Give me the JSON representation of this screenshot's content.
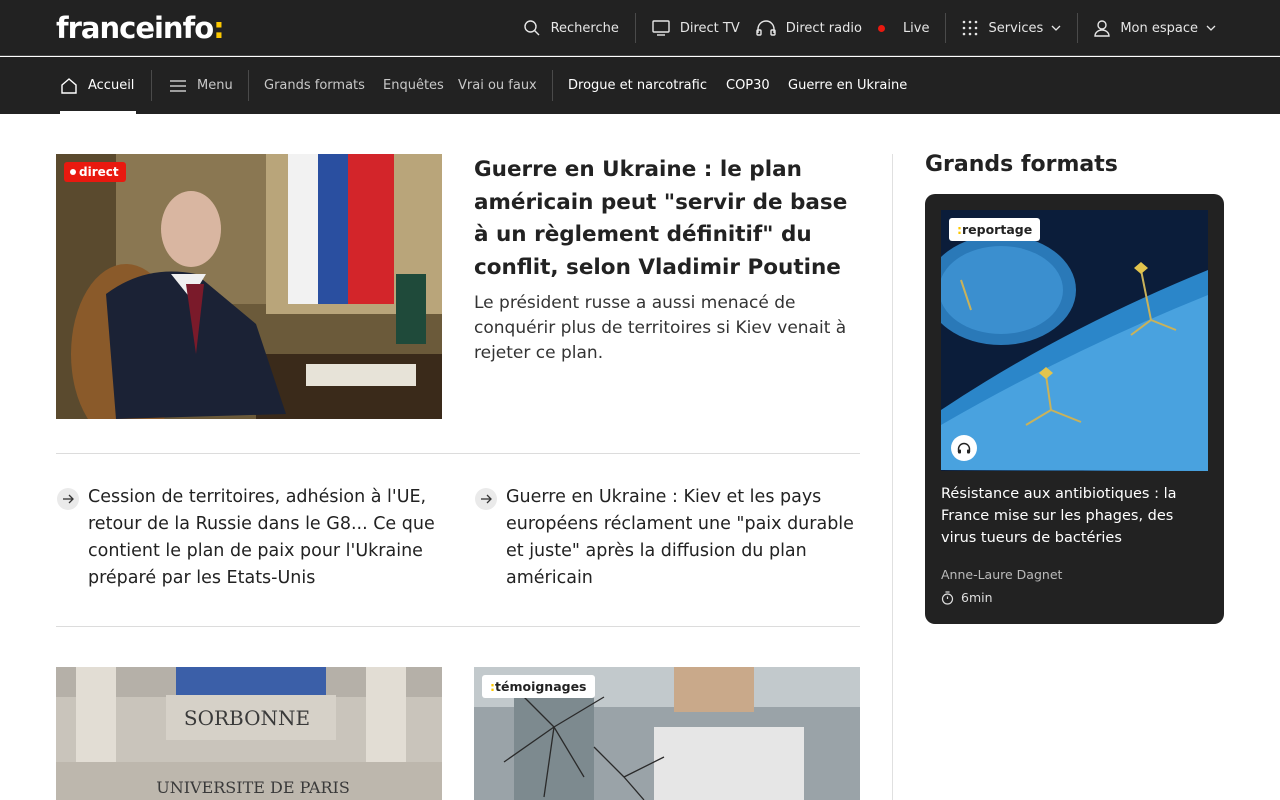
{
  "header": {
    "logo_text": "franceinfo",
    "logo_colon": ":",
    "nav": {
      "search": "Recherche",
      "direct_tv": "Direct TV",
      "direct_radio": "Direct radio",
      "live": "Live",
      "services": "Services",
      "account": "Mon espace"
    }
  },
  "subnav": {
    "home": "Accueil",
    "menu": "Menu",
    "grands_formats": "Grands formats",
    "enquetes": "Enquêtes",
    "vrai_ou_faux": "Vrai ou faux",
    "topic1": "Drogue et narcotrafic",
    "topic2": "COP30",
    "topic3": "Guerre en Ukraine"
  },
  "hero": {
    "badge": "direct",
    "title": "Guerre en Ukraine : le plan américain peut \"servir de base à un règlement définitif\" du conflit, selon Vladimir Poutine",
    "description": "Le président russe a aussi menacé de conquérir plus de territoires si Kiev venait à rejeter ce plan."
  },
  "related": [
    {
      "title": "Cession de territoires, adhésion à l'UE, retour de la Russie dans le G8... Ce que contient le plan de paix pour l'Ukraine préparé par les Etats-Unis"
    },
    {
      "title": "Guerre en Ukraine : Kiev et les pays européens réclament une \"paix durable et juste\" après la diffusion du plan américain"
    }
  ],
  "cards": [
    {
      "sign_top": "SORBONNE",
      "sign_bottom": "UNIVERSITE DE PARIS"
    },
    {
      "tag": "témoignages"
    }
  ],
  "grands_formats": {
    "section_title": "Grands formats",
    "tag": "reportage",
    "headline": "Résistance aux antibiotiques : la France mise sur les phages, des virus tueurs de bactéries",
    "author": "Anne-Laure Dagnet",
    "duration": "6min"
  },
  "colors": {
    "bar_bg": "#222222",
    "accent_yellow": "#fcc800",
    "live_red": "#e9190f"
  }
}
